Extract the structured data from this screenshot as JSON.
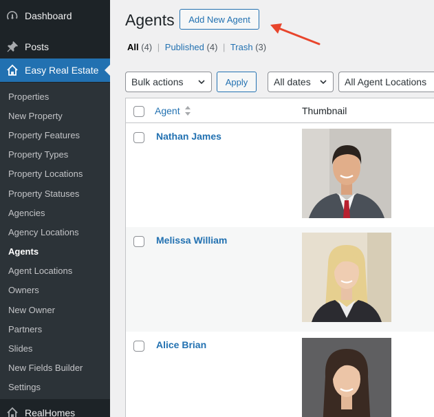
{
  "sidebar": {
    "top_items": [
      {
        "label": "Dashboard",
        "icon": "dashboard-icon"
      },
      {
        "label": "Posts",
        "icon": "pushpin-icon"
      },
      {
        "label": "Easy Real Estate",
        "icon": "house-icon",
        "current": true
      }
    ],
    "submenu": [
      {
        "label": "Properties"
      },
      {
        "label": "New Property"
      },
      {
        "label": "Property Features"
      },
      {
        "label": "Property Types"
      },
      {
        "label": "Property Locations"
      },
      {
        "label": "Property Statuses"
      },
      {
        "label": "Agencies"
      },
      {
        "label": "Agency Locations"
      },
      {
        "label": "Agents",
        "active": true
      },
      {
        "label": "Agent Locations"
      },
      {
        "label": "Owners"
      },
      {
        "label": "New Owner"
      },
      {
        "label": "Partners"
      },
      {
        "label": "Slides"
      },
      {
        "label": "New Fields Builder"
      },
      {
        "label": "Settings"
      }
    ],
    "bottom_item": {
      "label": "RealHomes",
      "icon": "house-icon"
    }
  },
  "header": {
    "title": "Agents",
    "add_new_label": "Add New Agent"
  },
  "filters_links": {
    "all_label": "All",
    "all_count": "(4)",
    "published_label": "Published",
    "published_count": "(4)",
    "trash_label": "Trash",
    "trash_count": "(3)",
    "separator": "|"
  },
  "toolbar": {
    "bulk_actions": "Bulk actions",
    "apply_label": "Apply",
    "dates": "All dates",
    "locations": "All Agent Locations"
  },
  "table": {
    "columns": [
      "Agent",
      "Thumbnail"
    ],
    "rows": [
      {
        "name": "Nathan James"
      },
      {
        "name": "Melissa William"
      },
      {
        "name": "Alice Brian"
      }
    ]
  },
  "colors": {
    "accent": "#2271b1",
    "sidebar_bg": "#1d2327",
    "submenu_bg": "#2c3338",
    "annotation_arrow": "#e8452c"
  }
}
